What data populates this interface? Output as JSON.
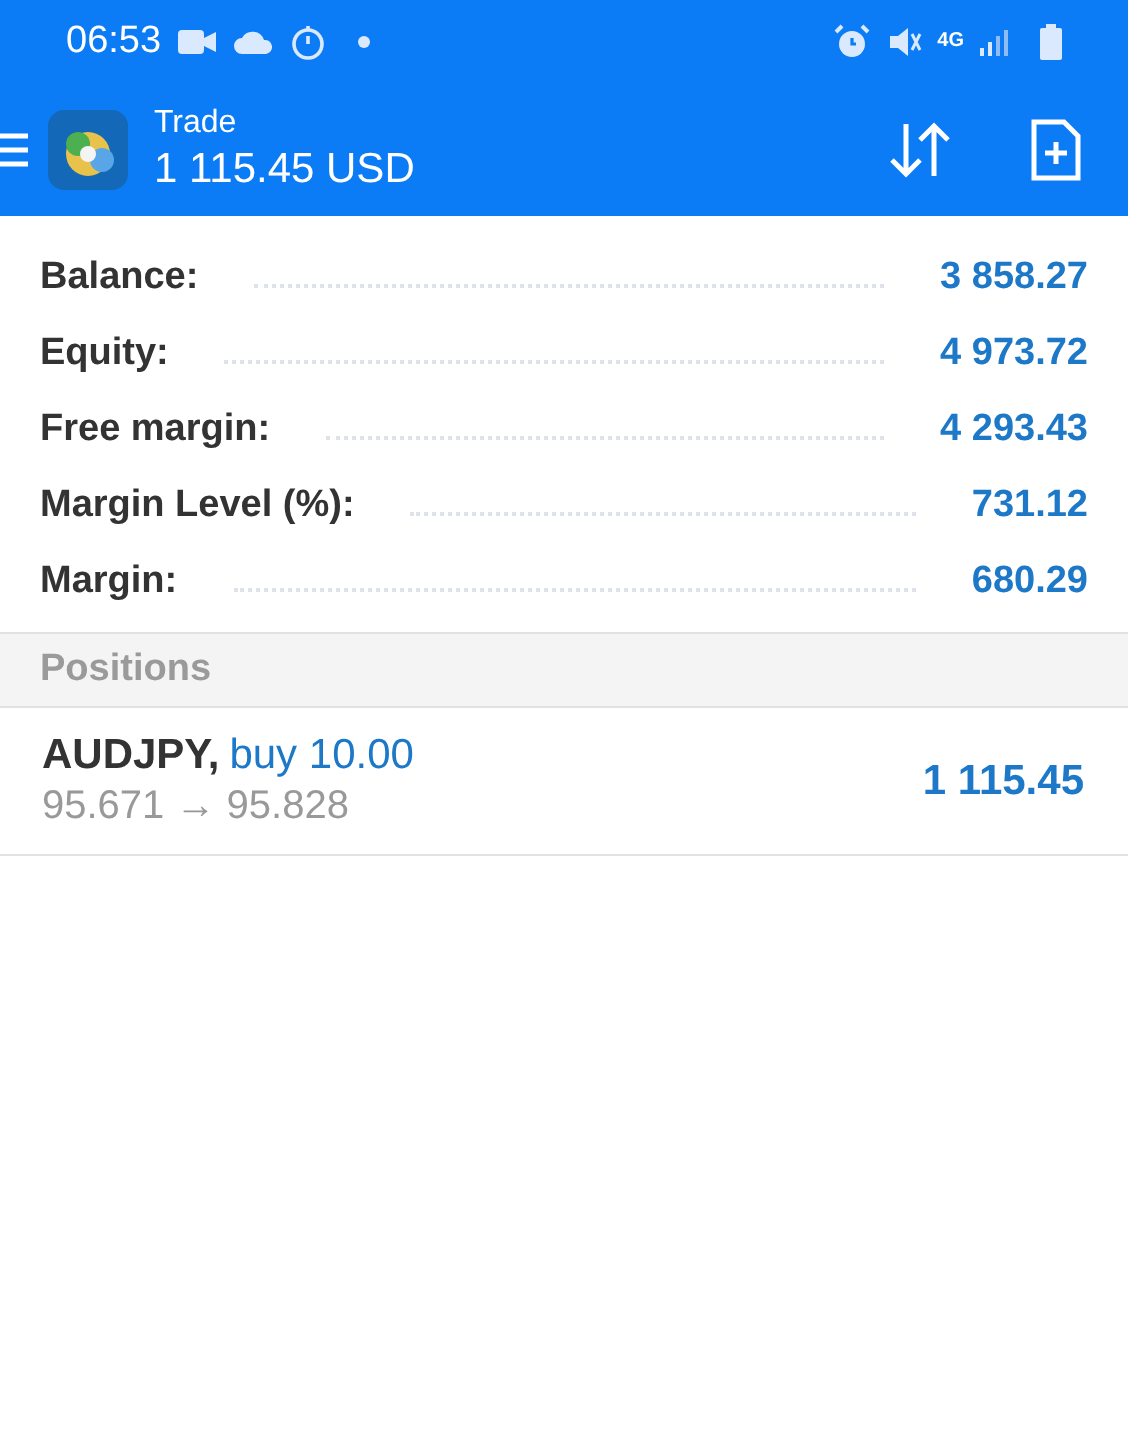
{
  "status_bar": {
    "time": "06:53",
    "network": "4G"
  },
  "header": {
    "title": "Trade",
    "balance": "1 115.45 USD"
  },
  "summary": [
    {
      "label": "Balance:",
      "value": "3 858.27"
    },
    {
      "label": "Equity:",
      "value": "4 973.72"
    },
    {
      "label": "Free margin:",
      "value": "4 293.43"
    },
    {
      "label": "Margin Level (%):",
      "value": "731.12"
    },
    {
      "label": "Margin:",
      "value": "680.29"
    }
  ],
  "positions": {
    "heading": "Positions",
    "items": [
      {
        "symbol": "AUDJPY,",
        "side": "buy 10.00",
        "prices": "95.671 → 95.828",
        "profit": "1 115.45"
      }
    ]
  }
}
